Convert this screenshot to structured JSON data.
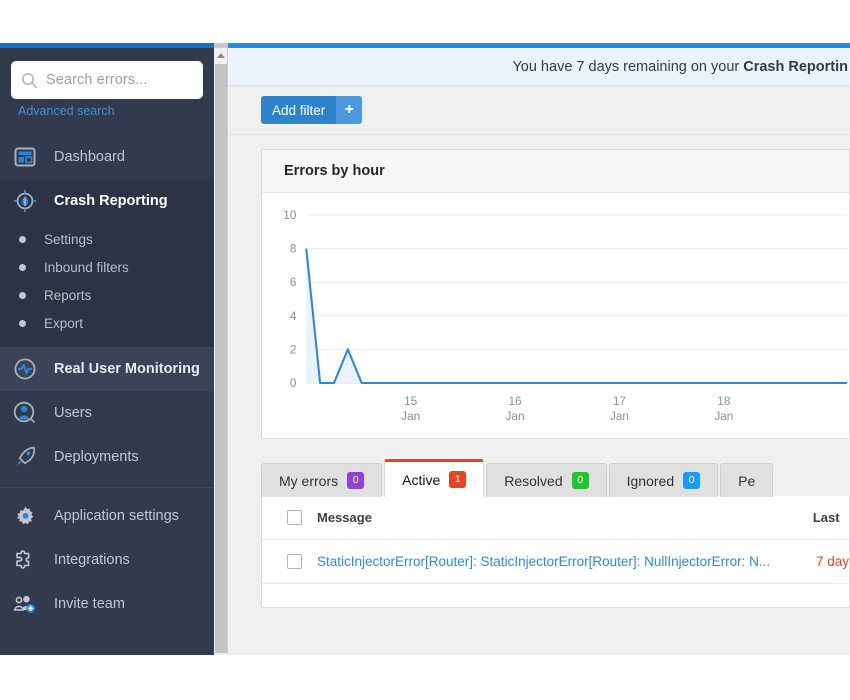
{
  "sidebar": {
    "search": {
      "placeholder": "Search errors...",
      "value": "",
      "icon": "search-icon"
    },
    "advanced_search": "Advanced search",
    "items": [
      {
        "label": "Dashboard",
        "icon": "dashboard-icon",
        "state": "normal"
      },
      {
        "label": "Crash Reporting",
        "icon": "bug-crosshair-icon",
        "state": "active"
      },
      {
        "label": "Real User Monitoring",
        "icon": "pulse-icon",
        "state": "highlight"
      },
      {
        "label": "Users",
        "icon": "user-icon",
        "state": "normal"
      },
      {
        "label": "Deployments",
        "icon": "rocket-icon",
        "state": "normal"
      },
      {
        "label": "Application settings",
        "icon": "gear-icon",
        "state": "normal"
      },
      {
        "label": "Integrations",
        "icon": "puzzle-icon",
        "state": "normal"
      },
      {
        "label": "Invite team",
        "icon": "add-user-icon",
        "state": "normal"
      }
    ],
    "subitems": [
      {
        "label": "Settings"
      },
      {
        "label": "Inbound filters"
      },
      {
        "label": "Reports"
      },
      {
        "label": "Export"
      }
    ]
  },
  "banner": {
    "prefix": "You have 7 days remaining on your ",
    "strong": "Crash Reportin"
  },
  "filterbar": {
    "add_filter_label": "Add filter",
    "plus_label": "+"
  },
  "chart_data": {
    "type": "line",
    "title": "Errors by hour",
    "xlabel": "",
    "ylabel": "",
    "ylim": [
      0,
      10
    ],
    "yticks": [
      0,
      2,
      4,
      6,
      8,
      10
    ],
    "grid": true,
    "legend": "none",
    "xtick_labels": [
      {
        "day": "15",
        "month": "Jan"
      },
      {
        "day": "16",
        "month": "Jan"
      },
      {
        "day": "17",
        "month": "Jan"
      },
      {
        "day": "18",
        "month": "Jan"
      }
    ],
    "series": [
      {
        "name": "Errors",
        "color": "#2e86d8",
        "fill": "#e8f3fc",
        "values": [
          8,
          0,
          0,
          2,
          0,
          0,
          0,
          0,
          0,
          0,
          0,
          0,
          0,
          0,
          0,
          0,
          0,
          0,
          0,
          0,
          0,
          0,
          0,
          0,
          0,
          0,
          0,
          0,
          0,
          0,
          0,
          0,
          0,
          0,
          0,
          0,
          0,
          0,
          0,
          0
        ]
      }
    ]
  },
  "tabs": [
    {
      "label": "My errors",
      "count": "0",
      "color": "#8e44d0",
      "selected": false
    },
    {
      "label": "Active",
      "count": "1",
      "color": "#e8431f",
      "selected": true
    },
    {
      "label": "Resolved",
      "count": "0",
      "color": "#25c232",
      "selected": false
    },
    {
      "label": "Ignored",
      "count": "0",
      "color": "#1b9aee",
      "selected": false
    },
    {
      "label": "Pe",
      "count": "",
      "color": "",
      "selected": false
    }
  ],
  "table": {
    "columns": {
      "message": "Message",
      "last_seen": "Last"
    },
    "rows": [
      {
        "message": "StaticInjectorError[Router]: StaticInjectorError[Router]: NullInjectorError: N...",
        "last_seen": "7 day"
      }
    ]
  },
  "colors": {
    "accent_blue": "#2e86d8",
    "sidebar_bg": "#323b4e",
    "active_tab_underline": "#e8431f"
  }
}
